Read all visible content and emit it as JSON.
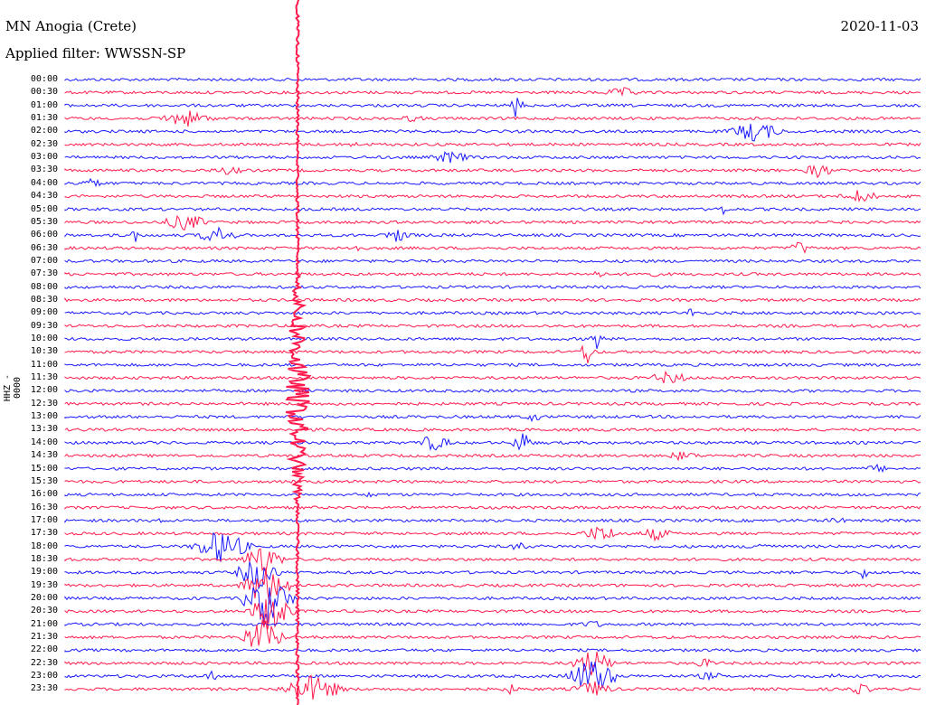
{
  "header": {
    "title": "MN Anogia (Crete)",
    "filter": "Applied filter: WWSSN-SP",
    "date": "2020-11-03"
  },
  "channel_label": "HHZ - 0000",
  "colors": {
    "blue": "#1a1aff",
    "red": "#ff1a4d"
  },
  "time_labels": [
    "00:00",
    "00:30",
    "01:00",
    "01:30",
    "02:00",
    "02:30",
    "03:00",
    "03:30",
    "04:00",
    "04:30",
    "05:00",
    "05:30",
    "06:00",
    "06:30",
    "07:00",
    "07:30",
    "08:00",
    "08:30",
    "09:00",
    "09:30",
    "10:00",
    "10:30",
    "11:00",
    "11:30",
    "12:00",
    "12:30",
    "13:00",
    "13:30",
    "14:00",
    "14:30",
    "15:00",
    "15:30",
    "16:00",
    "16:30",
    "17:00",
    "17:30",
    "18:00",
    "18:30",
    "19:00",
    "19:30",
    "20:00",
    "20:30",
    "21:00",
    "21:30",
    "22:00",
    "22:30",
    "23:00",
    "23:30"
  ]
}
